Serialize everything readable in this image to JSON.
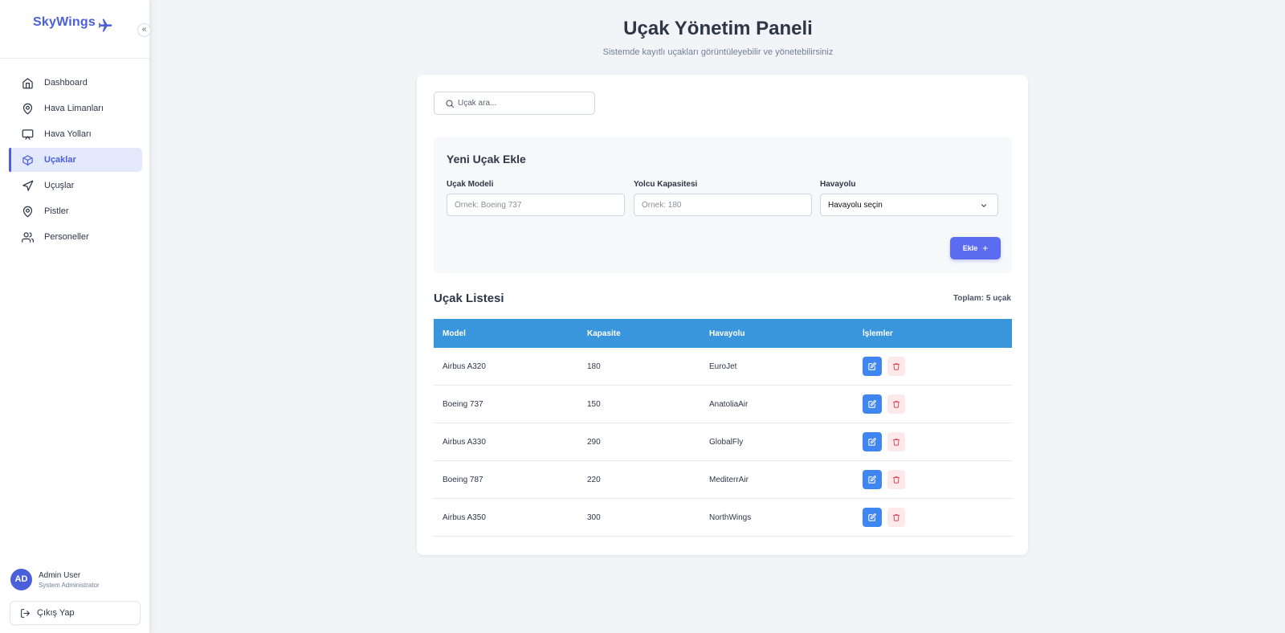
{
  "sidebar": {
    "brand": "SkyWings",
    "collapse_label": "«",
    "items": [
      {
        "label": "Dashboard",
        "icon": "home-icon"
      },
      {
        "label": "Hava Limanları",
        "icon": "map-pin-icon"
      },
      {
        "label": "Hava Yolları",
        "icon": "monitor-icon"
      },
      {
        "label": "Uçaklar",
        "icon": "box-icon",
        "active": true
      },
      {
        "label": "Uçuşlar",
        "icon": "send-icon"
      },
      {
        "label": "Pistler",
        "icon": "map-pin-icon"
      },
      {
        "label": "Personeller",
        "icon": "users-icon"
      }
    ],
    "user": {
      "initials": "AD",
      "name": "Admin User",
      "role": "System Administrator"
    },
    "logout_label": "Çıkış Yap"
  },
  "header": {
    "title": "Uçak Yönetim Paneli",
    "subtitle": "Sistemde kayıtlı uçakları görüntüleyebilir ve yönetebilirsiniz"
  },
  "search": {
    "placeholder": "Uçak ara...",
    "value": ""
  },
  "add_form": {
    "title": "Yeni Uçak Ekle",
    "model_label": "Uçak Modeli",
    "model_placeholder": "Örnek: Boeing 737",
    "capacity_label": "Yolcu Kapasitesi",
    "capacity_placeholder": "Örnek: 180",
    "airline_label": "Havayolu",
    "airline_selected": "Havayolu seçin",
    "submit_label": "Ekle",
    "submit_icon": "+"
  },
  "list": {
    "title": "Uçak Listesi",
    "total": "Toplam: 5 uçak",
    "columns": [
      "Model",
      "Kapasite",
      "Havayolu",
      "İşlemler"
    ],
    "rows": [
      {
        "model": "Airbus A320",
        "capacity": "180",
        "airline": "EuroJet"
      },
      {
        "model": "Boeing 737",
        "capacity": "150",
        "airline": "AnatoliaAir"
      },
      {
        "model": "Airbus A330",
        "capacity": "290",
        "airline": "GlobalFly"
      },
      {
        "model": "Boeing 787",
        "capacity": "220",
        "airline": "MediterrAir"
      },
      {
        "model": "Airbus A350",
        "capacity": "300",
        "airline": "NorthWings"
      }
    ]
  },
  "colors": {
    "accent": "#4a5fd9",
    "table_header": "#3996dc",
    "edit_button": "#3f86f0",
    "delete_button_bg": "#fde8ea",
    "delete_icon": "#e05264"
  }
}
